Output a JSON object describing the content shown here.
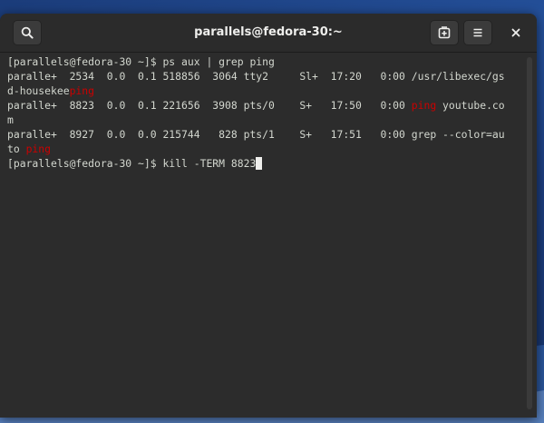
{
  "window": {
    "title": "parallels@fedora-30:~"
  },
  "headerbar": {
    "search_icon": "search-icon",
    "new_tab_icon": "new-tab-icon",
    "menu_icon": "hamburger-menu-icon",
    "close_icon": "close-icon"
  },
  "terminal": {
    "lines": [
      {
        "segments": [
          {
            "text": "[parallels@fedora-30 ~]$ ps aux | grep ping",
            "hl": false
          }
        ]
      },
      {
        "segments": [
          {
            "text": "paralle+  2534  0.0  0.1 518856  3064 tty2     Sl+  17:20   0:00 /usr/libexec/gs",
            "hl": false
          }
        ]
      },
      {
        "segments": [
          {
            "text": "d-housekee",
            "hl": false
          },
          {
            "text": "ping",
            "hl": true
          }
        ]
      },
      {
        "segments": [
          {
            "text": "paralle+  8823  0.0  0.1 221656  3908 pts/0    S+   17:50   0:00 ",
            "hl": false
          },
          {
            "text": "ping",
            "hl": true
          },
          {
            "text": " youtube.co",
            "hl": false
          }
        ]
      },
      {
        "segments": [
          {
            "text": "m",
            "hl": false
          }
        ]
      },
      {
        "segments": [
          {
            "text": "paralle+  8927  0.0  0.0 215744   828 pts/1    S+   17:51   0:00 grep --color=au",
            "hl": false
          }
        ]
      },
      {
        "segments": [
          {
            "text": "to ",
            "hl": false
          },
          {
            "text": "ping",
            "hl": true
          }
        ]
      },
      {
        "segments": [
          {
            "text": "[parallels@fedora-30 ~]$ kill -TERM 8823",
            "hl": false
          }
        ],
        "cursor": true
      }
    ],
    "highlight_color": "#cc0000",
    "text_color": "#d3d7cf",
    "background_color": "#2c2c2c"
  }
}
